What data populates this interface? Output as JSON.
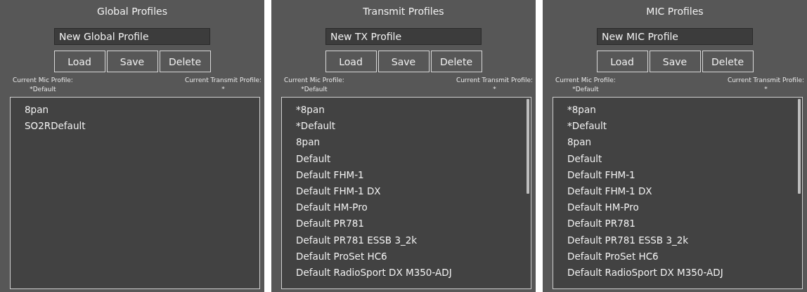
{
  "panels": [
    {
      "title": "Global Profiles",
      "name_field": {
        "value": "New Global Profile"
      },
      "buttons": [
        "Load",
        "Save",
        "Delete"
      ],
      "current_mic_label": "Current Mic Profile:",
      "current_mic_value": "*Default",
      "current_tx_label": "Current Transmit Profile:",
      "current_tx_value": "*",
      "scrollbar": false,
      "profiles": [
        "8pan",
        "SO2RDefault"
      ]
    },
    {
      "title": "Transmit Profiles",
      "name_field": {
        "value": "New TX Profile"
      },
      "buttons": [
        "Load",
        "Save",
        "Delete"
      ],
      "current_mic_label": "Current Mic Profile:",
      "current_mic_value": "*Default",
      "current_tx_label": "Current Transmit Profile:",
      "current_tx_value": "*",
      "scrollbar": true,
      "profiles": [
        "*8pan",
        "*Default",
        "8pan",
        "Default",
        "Default FHM-1",
        "Default FHM-1 DX",
        "Default HM-Pro",
        "Default PR781",
        "Default PR781 ESSB 3_2k",
        "Default ProSet HC6",
        "Default RadioSport DX M350-ADJ"
      ]
    },
    {
      "title": "MIC Profiles",
      "name_field": {
        "value": "New MIC Profile"
      },
      "buttons": [
        "Load",
        "Save",
        "Delete"
      ],
      "current_mic_label": "Current Mic Profile:",
      "current_mic_value": "*Default",
      "current_tx_label": "Current Transmit Profile:",
      "current_tx_value": "*",
      "scrollbar": true,
      "profiles": [
        "*8pan",
        "*Default",
        "8pan",
        "Default",
        "Default FHM-1",
        "Default FHM-1 DX",
        "Default HM-Pro",
        "Default PR781",
        "Default PR781 ESSB 3_2k",
        "Default ProSet HC6",
        "Default RadioSport DX M350-ADJ"
      ]
    }
  ]
}
